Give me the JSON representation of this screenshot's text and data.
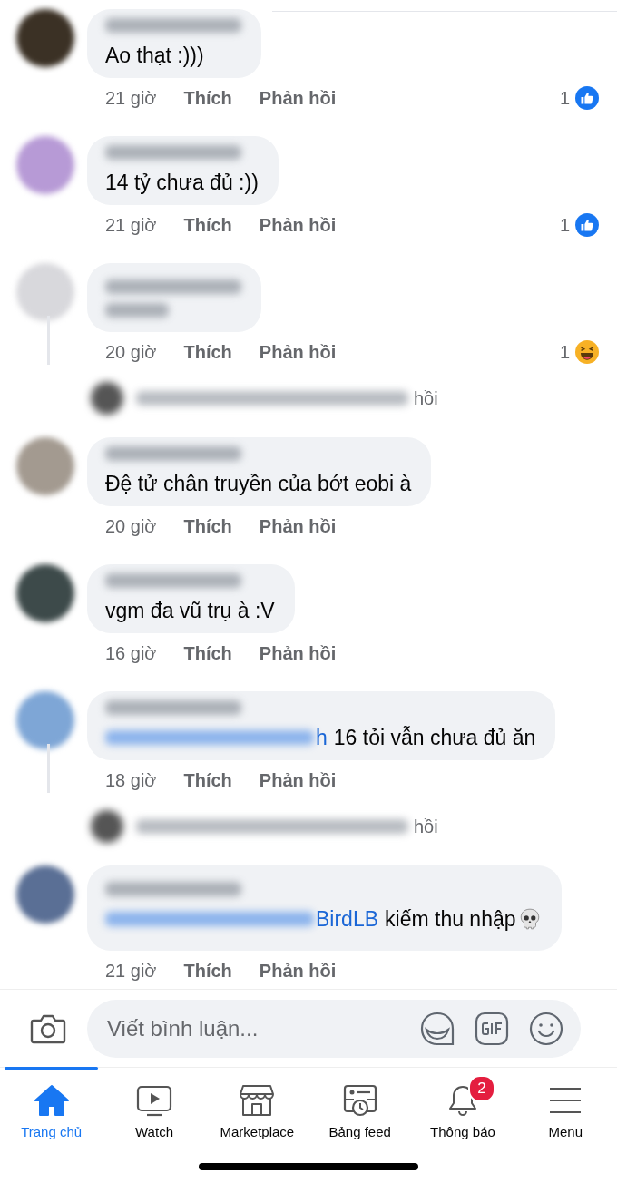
{
  "comments": [
    {
      "kind": "text",
      "color": "#3b3125",
      "text": "Ao thạt :)))",
      "time": "21 giờ",
      "like_label": "Thích",
      "reply_label": "Phản hồi",
      "reaction": {
        "kind": "like",
        "count": "1"
      },
      "thread": false
    },
    {
      "kind": "text",
      "color": "#b79ad6",
      "text": "14 tỷ chưa đủ :))",
      "time": "21 giờ",
      "like_label": "Thích",
      "reply_label": "Phản hồi",
      "reaction": {
        "kind": "like",
        "count": "1"
      },
      "thread": false
    },
    {
      "kind": "blurred",
      "color": "#d8d8dc",
      "time": "20 giờ",
      "like_label": "Thích",
      "reply_label": "Phản hồi",
      "reaction": {
        "kind": "haha",
        "count": "1"
      },
      "thread": true,
      "reply_preview": "hồi"
    },
    {
      "kind": "text",
      "color": "#a39a90",
      "text": "Đệ tử chân truyền của bớt eobi à",
      "time": "20 giờ",
      "like_label": "Thích",
      "reply_label": "Phản hồi",
      "thread": false
    },
    {
      "kind": "text",
      "color": "#3d4a4a",
      "text": "vgm đa vũ trụ à :V",
      "time": "16 giờ",
      "like_label": "Thích",
      "reply_label": "Phản hồi",
      "thread": false
    },
    {
      "kind": "mention",
      "color": "#7ea6d6",
      "mention": "h",
      "text": "16 tỏi vẫn chưa đủ ăn",
      "time": "18 giờ",
      "like_label": "Thích",
      "reply_label": "Phản hồi",
      "thread": true,
      "reply_preview": "hồi"
    },
    {
      "kind": "emoji",
      "color": "#5a6f95",
      "mention": "BirdLB",
      "text": "kiếm thu nhập",
      "time": "21 giờ",
      "like_label": "Thích",
      "reply_label": "Phản hồi",
      "thread": false
    }
  ],
  "composer": {
    "placeholder": "Viết bình luận..."
  },
  "tabs": [
    {
      "label": "Trang chủ",
      "selected": true
    },
    {
      "label": "Watch",
      "selected": false
    },
    {
      "label": "Marketplace",
      "selected": false
    },
    {
      "label": "Bảng feed",
      "selected": false
    },
    {
      "label": "Thông báo",
      "selected": false,
      "badge": "2"
    },
    {
      "label": "Menu",
      "selected": false
    }
  ]
}
